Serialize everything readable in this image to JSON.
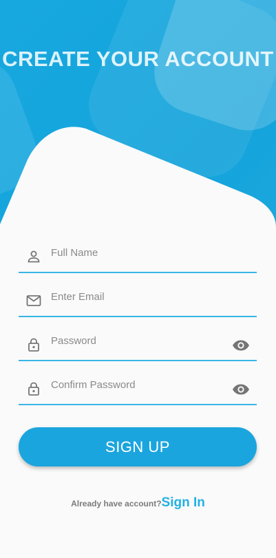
{
  "header": {
    "title": "CREATE YOUR ACCOUNT"
  },
  "form": {
    "full_name": {
      "placeholder": "Full Name",
      "icon": "person-icon"
    },
    "email": {
      "placeholder": "Enter Email",
      "icon": "mail-icon"
    },
    "password": {
      "placeholder": "Password",
      "icon": "lock-icon",
      "toggle_icon": "eye-icon"
    },
    "confirm_password": {
      "placeholder": "Confirm Password",
      "icon": "lock-icon",
      "toggle_icon": "eye-icon"
    }
  },
  "actions": {
    "signup_label": "SIGN UP"
  },
  "footer": {
    "question": "Already have account?",
    "signin_label": "Sign In"
  },
  "colors": {
    "primary": "#1ba5de",
    "accent_line": "#37b6e6",
    "background": "#fafafa"
  }
}
